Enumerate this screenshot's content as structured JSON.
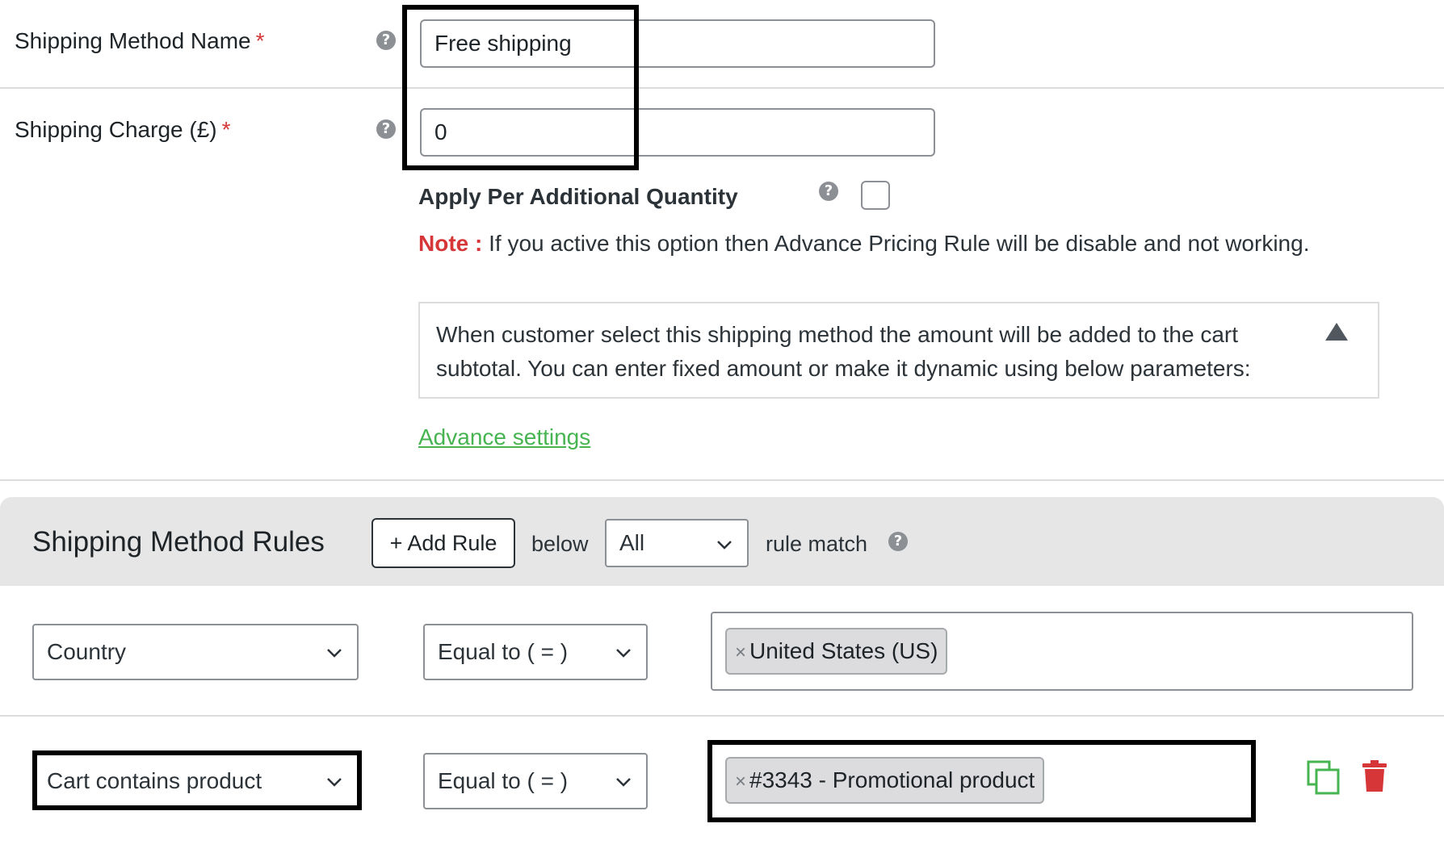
{
  "fields": {
    "method_name": {
      "label": "Shipping Method Name",
      "required_mark": "*",
      "value": "Free shipping"
    },
    "shipping_charge": {
      "label": "Shipping Charge (£)",
      "required_mark": "*",
      "value": "0"
    },
    "help_glyph": "?"
  },
  "additional_quantity": {
    "label": "Apply Per Additional Quantity",
    "checked": false,
    "note_label": "Note :",
    "note_text": "If you active this option then Advance Pricing Rule will be disable and not working."
  },
  "info_box": {
    "text": "When customer select this shipping method the amount will be added to the cart subtotal. You can enter fixed amount or make it dynamic using below parameters:",
    "toggle_icon": "triangle-up-icon"
  },
  "advance_settings_link": "Advance settings",
  "rules": {
    "title": "Shipping Method Rules",
    "add_rule_label": "+ Add Rule",
    "below_text": "below",
    "match_value": "All",
    "rule_match_text": "rule match",
    "rows": [
      {
        "condition": "Country",
        "operator": "Equal to ( = )",
        "tokens": [
          "United States (US)"
        ]
      },
      {
        "condition": "Cart contains product",
        "operator": "Equal to ( = )",
        "tokens": [
          "#3343 - Promotional product"
        ]
      }
    ],
    "token_remove_glyph": "×"
  },
  "colors": {
    "accent_green": "#46b450",
    "required_red": "#d63638",
    "delete_red": "#d63638",
    "header_gray": "#e6e6e6"
  },
  "icons": {
    "copy": "copy-icon",
    "delete": "trash-icon"
  }
}
